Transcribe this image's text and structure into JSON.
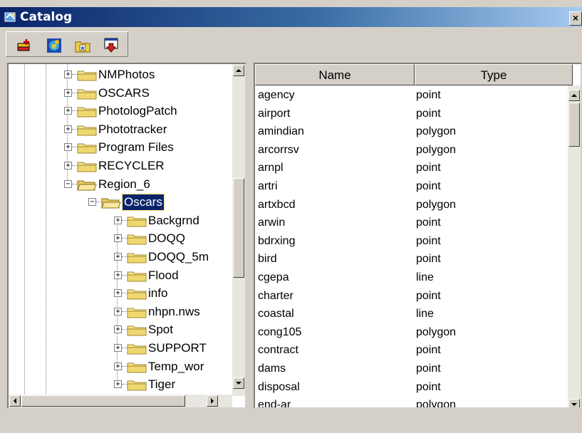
{
  "window": {
    "title": "Catalog",
    "close_label": "×"
  },
  "toolbar": {
    "buttons": [
      "add-layer-icon",
      "internet-explorer-icon",
      "folder-star-icon",
      "export-icon"
    ]
  },
  "tree": {
    "items": [
      {
        "label": "NMPhotos",
        "expander": "+"
      },
      {
        "label": "OSCARS",
        "expander": "+"
      },
      {
        "label": "PhotologPatch",
        "expander": "+"
      },
      {
        "label": "Phototracker",
        "expander": "+"
      },
      {
        "label": "Program Files",
        "expander": "+"
      },
      {
        "label": "RECYCLER",
        "expander": "+"
      },
      {
        "label": "Region_6",
        "expander": "−"
      },
      {
        "label": "Oscars",
        "expander": "−"
      },
      {
        "label": "Backgrnd",
        "expander": "+"
      },
      {
        "label": "DOQQ",
        "expander": "+"
      },
      {
        "label": "DOQQ_5m",
        "expander": "+"
      },
      {
        "label": "Flood",
        "expander": "+"
      },
      {
        "label": "info",
        "expander": "+"
      },
      {
        "label": "nhpn.nws",
        "expander": "+"
      },
      {
        "label": "Spot",
        "expander": "+"
      },
      {
        "label": "SUPPORT",
        "expander": "+"
      },
      {
        "label": "Temp_wor",
        "expander": "+"
      },
      {
        "label": "Tiger",
        "expander": "+"
      }
    ]
  },
  "list": {
    "columns": [
      "Name",
      "Type"
    ],
    "rows": [
      [
        "agency",
        "point"
      ],
      [
        "airport",
        "point"
      ],
      [
        "amindian",
        "polygon"
      ],
      [
        "arcorrsv",
        "polygon"
      ],
      [
        "arnpl",
        "point"
      ],
      [
        "artri",
        "point"
      ],
      [
        "artxbcd",
        "polygon"
      ],
      [
        "arwin",
        "point"
      ],
      [
        "bdrxing",
        "point"
      ],
      [
        "bird",
        "point"
      ],
      [
        "cgepa",
        "line"
      ],
      [
        "charter",
        "point"
      ],
      [
        "coastal",
        "line"
      ],
      [
        "cong105",
        "polygon"
      ],
      [
        "contract",
        "point"
      ],
      [
        "dams",
        "point"
      ],
      [
        "disposal",
        "point"
      ],
      [
        "end-ar",
        "polygon"
      ]
    ]
  }
}
